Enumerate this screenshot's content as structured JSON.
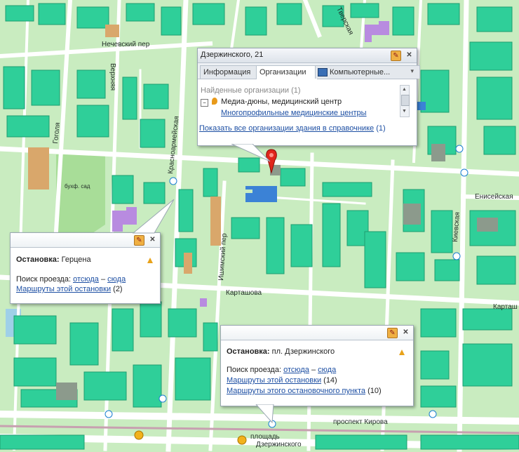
{
  "map": {
    "streets": {
      "nechevsky": "Нечевский пер",
      "verkhnyaya": "Верхняя",
      "gogolya": "Гоголя",
      "krasnoarmeyskaya": "Красноармейская",
      "tverskaya": "Тверская",
      "eniseyskaya": "Енисейская",
      "kievskaya": "Киевская",
      "ishimsky": "Ишимский пер",
      "kartashova": "Карташова",
      "kartashova_right": "Карташ",
      "kirova": "проспект Кирова",
      "ploshchad": "площадь",
      "dzerzhinskogo": "Дзержинского",
      "bukh_sad": "бухф. сад"
    },
    "colors": {
      "ground": "#c9ecc0",
      "building": "#2fcf99",
      "building_dark": "#1d9e70",
      "road": "#ffffff",
      "park": "#a8dd98",
      "purple": "#b88be0",
      "tan": "#d9a76b",
      "blue": "#3b82d6",
      "rail": "#c7a0b0",
      "marker": "#e0261c"
    }
  },
  "popup_building": {
    "title": "Дзержинского, 21",
    "tabs": [
      "Информация",
      "Организации",
      "Компьютерные..."
    ],
    "found_label": "Найденные организации (1)",
    "org_name": "Медиа-дюны, медицинский центр",
    "org_category": "Многопрофильные медицинские центры",
    "show_all": "Показать все организации здания в справочнике",
    "show_all_count": "(1)"
  },
  "popup_gertsena": {
    "stop_label": "Остановка:",
    "stop_name": "Герцена",
    "search_label": "Поиск проезда:",
    "from": "отсюда",
    "dash": "–",
    "to": "сюда",
    "routes": "Маршруты этой остановки",
    "routes_count": "(2)"
  },
  "popup_dzerzh": {
    "stop_label": "Остановка:",
    "stop_name": "пл. Дзержинского",
    "search_label": "Поиск проезда:",
    "from": "отсюда",
    "dash": "–",
    "to": "сюда",
    "routes": "Маршруты этой остановки",
    "routes_count": "(14)",
    "point_routes": "Маршруты этого остановочного пункта",
    "point_routes_count": "(10)"
  }
}
